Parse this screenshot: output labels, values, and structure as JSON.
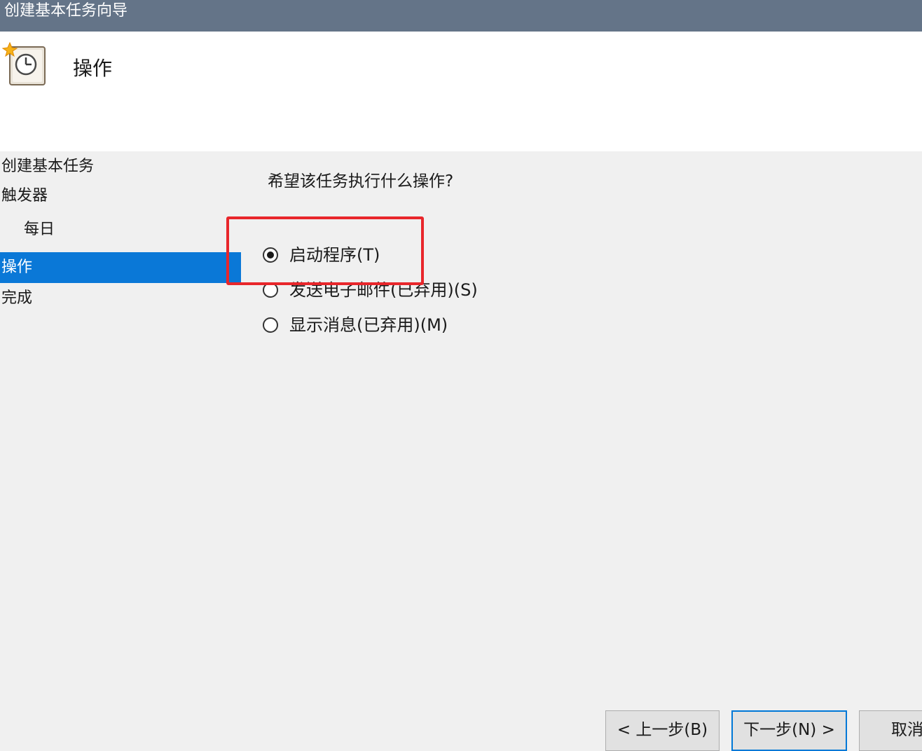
{
  "window": {
    "title": "创建基本任务向导"
  },
  "header": {
    "icon": "task-scheduler-clock-icon",
    "title": "操作"
  },
  "nav": {
    "items": [
      {
        "label": "创建基本任务",
        "selected": false
      },
      {
        "label": "触发器",
        "selected": false
      },
      {
        "label": "每日",
        "selected": false
      },
      {
        "label": "操作",
        "selected": true
      },
      {
        "label": "完成",
        "selected": false
      }
    ]
  },
  "main": {
    "question": "希望该任务执行什么操作?",
    "options": [
      {
        "label": "启动程序(T)",
        "checked": true
      },
      {
        "label": "发送电子邮件(已弃用)(S)",
        "checked": false
      },
      {
        "label": "显示消息(已弃用)(M)",
        "checked": false
      }
    ]
  },
  "annotation": {
    "color": "#e8262b"
  },
  "buttons": {
    "back": "< 上一步(B)",
    "next": "下一步(N) >",
    "cancel": "取消"
  },
  "colors": {
    "titlebar": "#647488",
    "selection": "#0a78d7",
    "default_button_border": "#0078d7"
  }
}
